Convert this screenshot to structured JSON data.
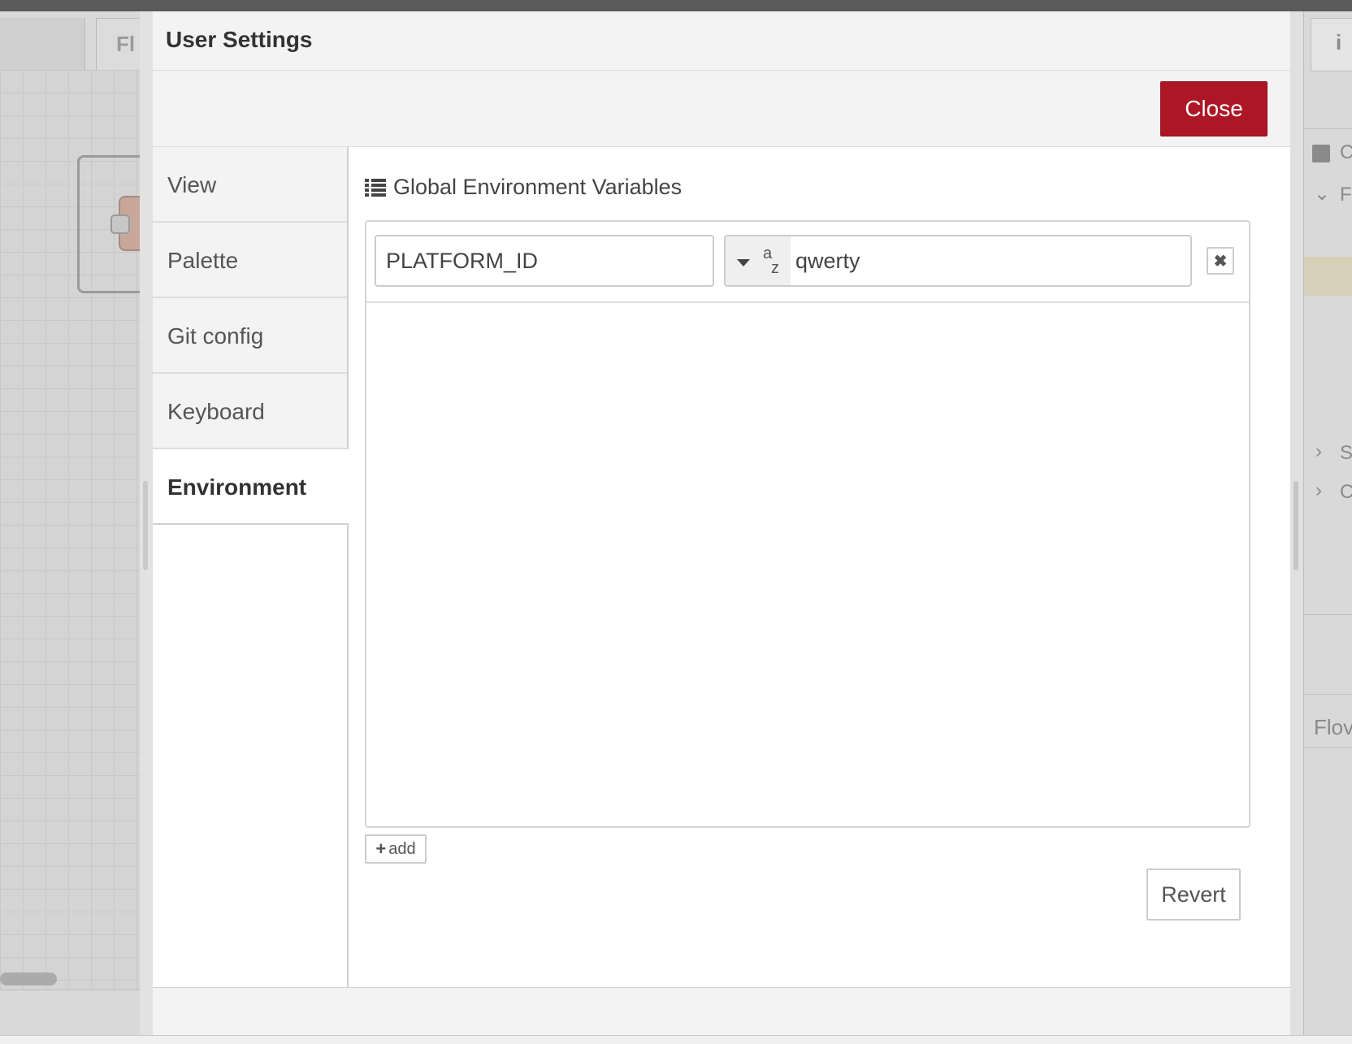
{
  "background": {
    "flow_tab_label": "Fl",
    "sidebar_info_icon": "i",
    "sidebar_flow_label": "Flov",
    "sidebar_letters": [
      "C",
      "F",
      "S",
      "C"
    ]
  },
  "dialog": {
    "title": "User Settings",
    "close_label": "Close",
    "tabs": [
      {
        "label": "View"
      },
      {
        "label": "Palette"
      },
      {
        "label": "Git config"
      },
      {
        "label": "Keyboard"
      },
      {
        "label": "Environment"
      }
    ],
    "active_tab": "Environment",
    "environment": {
      "section_title": "Global Environment Variables",
      "rows": [
        {
          "name": "PLATFORM_ID",
          "type": "string",
          "type_icon_top": "a",
          "type_icon_bottom": "z",
          "value": "qwerty"
        }
      ],
      "remove_glyph": "✖",
      "add_label": "add",
      "add_glyph": "+",
      "revert_label": "Revert"
    }
  },
  "colors": {
    "primary_button": "#ad1625",
    "panel_bg": "#f3f3f3"
  }
}
